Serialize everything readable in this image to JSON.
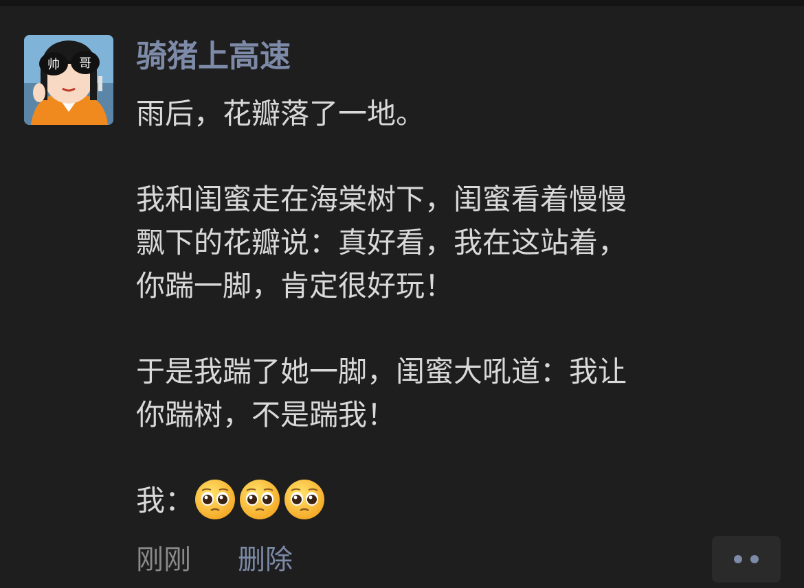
{
  "post": {
    "username": "骑猪上高速",
    "avatar_text_left": "帅",
    "avatar_text_right": "哥",
    "paragraphs": [
      "雨后，花瓣落了一地。",
      "我和闺蜜走在海棠树下，闺蜜看着慢慢\n飘下的花瓣说：真好看，我在这站着，\n你踹一脚，肯定很好玩！",
      "于是我踹了她一脚，闺蜜大吼道：我让\n你踹树，不是踹我！"
    ],
    "last_line_prefix": "我：",
    "emoji_icon": "pleading-face-emoji",
    "emoji_count": 3,
    "time": "刚刚",
    "delete_label": "删除",
    "more_icon": "more-dots-icon"
  },
  "colors": {
    "background": "#1e1e1e",
    "username": "#7d8aa8",
    "text": "#d9d9d9",
    "time": "#8a8a8a",
    "link": "#7d8aa8"
  }
}
